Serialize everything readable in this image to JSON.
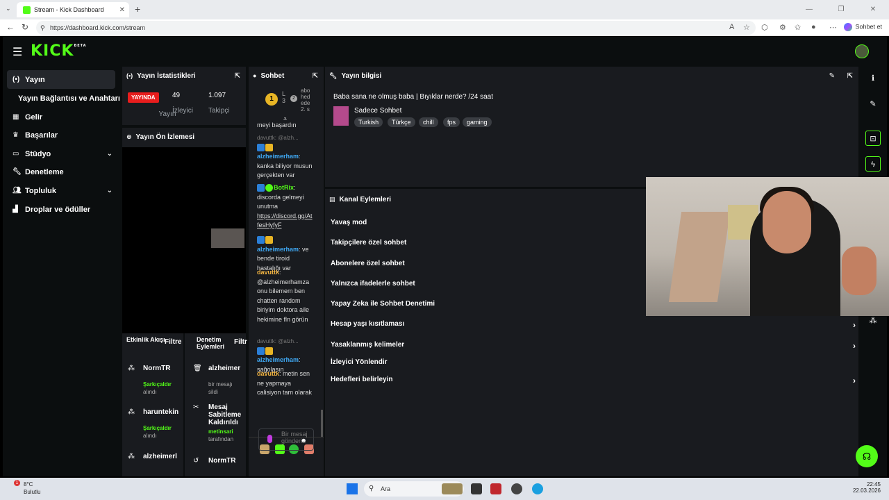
{
  "browser": {
    "tab_title": "Stream - Kick Dashboard",
    "url": "https://dashboard.kick.com/stream",
    "copilot_label": "Sohbet et"
  },
  "app": {
    "logo": "KICK",
    "logo_badge": "BETA"
  },
  "sidebar": {
    "items": [
      {
        "label": "Yayın",
        "icon": "broadcast-icon"
      },
      {
        "label": "Yayın Bağlantısı ve Anahtarı"
      },
      {
        "label": "Gelir",
        "icon": "chart-icon"
      },
      {
        "label": "Başarılar",
        "icon": "trophy-icon"
      },
      {
        "label": "Stüdyo",
        "icon": "studio-icon"
      },
      {
        "label": "Denetleme",
        "icon": "wrench-icon"
      },
      {
        "label": "Topluluk",
        "icon": "people-icon"
      },
      {
        "label": "Droplar ve ödüller",
        "icon": "drops-icon"
      }
    ]
  },
  "stats": {
    "title": "Yayın İstatistikleri",
    "live_badge": "YAYINDA",
    "live_label": "Yayın",
    "viewers_value": "49",
    "viewers_label": "İzleyici",
    "followers_value": "1.097",
    "followers_label": "Takipçi"
  },
  "preview": {
    "title": "Yayın Ön İzlemesi"
  },
  "activity": {
    "title": "Etkinlik Akışı",
    "filter": "Filtre",
    "items": [
      {
        "name": "NormTR",
        "sub1": "Şarkıçaldır",
        "sub2": "alındı"
      },
      {
        "name": "haruntekin",
        "sub1": "Şarkıçaldır",
        "sub2": "alındı"
      },
      {
        "name": "alzheimerl"
      }
    ]
  },
  "moderation": {
    "title": "Denetim Eylemleri",
    "filter": "Filtr",
    "items": [
      {
        "name": "alzheimer",
        "sub1": "bir mesajı",
        "sub2": "sildi"
      },
      {
        "name": "Mesaj Sabitleme Kaldırıldı",
        "sub1": "metinsari",
        "sub2": "tarafından"
      },
      {
        "name": "NormTR"
      }
    ]
  },
  "chat": {
    "title": "Sohbet",
    "pinned_level": "1",
    "pinned_text": "abo hed ede 2. s ",
    "cut_top": "meyi başardın",
    "reply_label": "davuttk: @alzh...",
    "messages": [
      {
        "user": "alzheimerham",
        "text": ": kanka biliyor musun gerçekten var"
      },
      {
        "user": "BotRix",
        "text": ": discorda gelmeyi unutma",
        "link": "https://discord.gg/AtfesHyfyF"
      },
      {
        "user": "alzheimerham",
        "text": ": ve bende tiroid hastalığı var"
      },
      {
        "user": "davuttk",
        "text": ": @alzheimerhamza onu bilemem ben chatten random biriyim doktora aile hekimine fln görün"
      },
      {
        "user": "alzheimerham",
        "text": ": sağolasın"
      },
      {
        "user": "davuttk",
        "text": ": metin sen ne yapmaya calisiyon tam olarak"
      }
    ],
    "input_placeholder": "Bir mesaj gönderin",
    "infinity": "∞",
    "count": "0"
  },
  "info": {
    "title": "Yayın bilgisi",
    "stream_title": "Baba sana ne olmuş baba | Bıyıklar nerde? /24 saat",
    "category": "Sadece Sohbet",
    "tags": [
      "Turkish",
      "Türkçe",
      "chill",
      "fps",
      "gaming"
    ]
  },
  "channel_actions": {
    "title": "Kanal Eylemleri",
    "items": [
      {
        "label": "Yavaş mod"
      },
      {
        "label": "Takipçilere özel sohbet"
      },
      {
        "label": "Abonelere özel sohbet"
      },
      {
        "label": "Yalnızca ifadelerle sohbet"
      },
      {
        "label": "Yapay Zeka ile Sohbet Denetimi"
      },
      {
        "label": "Hesap yaşı kısıtlaması"
      },
      {
        "label": "Yasaklanmış kelimeler"
      },
      {
        "label": "İzleyici Yönlendir"
      },
      {
        "label": "Hedefleri belirleyin"
      }
    ]
  },
  "taskbar": {
    "weather_temp": "8°C",
    "weather_cond": "Bulutlu",
    "notif": "1",
    "search": "Ara",
    "time": "22:45",
    "date": "22.03.2026"
  },
  "colors": {
    "accent": "#53fc18",
    "live": "#e81d1d",
    "panel": "#191b1f"
  }
}
